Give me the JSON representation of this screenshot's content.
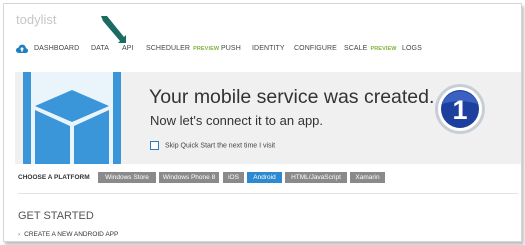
{
  "service": {
    "name": "todylist"
  },
  "nav": {
    "items": [
      {
        "label": "DASHBOARD",
        "preview": ""
      },
      {
        "label": "DATA",
        "preview": ""
      },
      {
        "label": "API",
        "preview": ""
      },
      {
        "label": "SCHEDULER",
        "preview": "PREVIEW"
      },
      {
        "label": "PUSH",
        "preview": ""
      },
      {
        "label": "IDENTITY",
        "preview": ""
      },
      {
        "label": "CONFIGURE",
        "preview": ""
      },
      {
        "label": "SCALE",
        "preview": "PREVIEW"
      },
      {
        "label": "LOGS",
        "preview": ""
      }
    ],
    "cloud_icon": "cloud-upload-icon",
    "accent": "#1e7fc1"
  },
  "annotation": {
    "arrow_icon": "pointer-arrow-icon",
    "color": "#1b6b63"
  },
  "banner": {
    "title": "Your mobile service was created.",
    "subtitle": "Now let's connect it to an app.",
    "skip_label": "Skip Quick Start the next time I visit",
    "step_number": "1",
    "background": "#f0f0f0"
  },
  "platform": {
    "label": "CHOOSE A PLATFORM",
    "options": [
      "Windows Store",
      "Windows Phone 8",
      "iOS",
      "Android",
      "HTML/JavaScript",
      "Xamarin"
    ],
    "selected": "Android",
    "active_color": "#2e8ad0",
    "inactive_color": "#8a8a8a"
  },
  "get_started": {
    "heading": "GET STARTED",
    "link": "CREATE A NEW ANDROID APP"
  }
}
